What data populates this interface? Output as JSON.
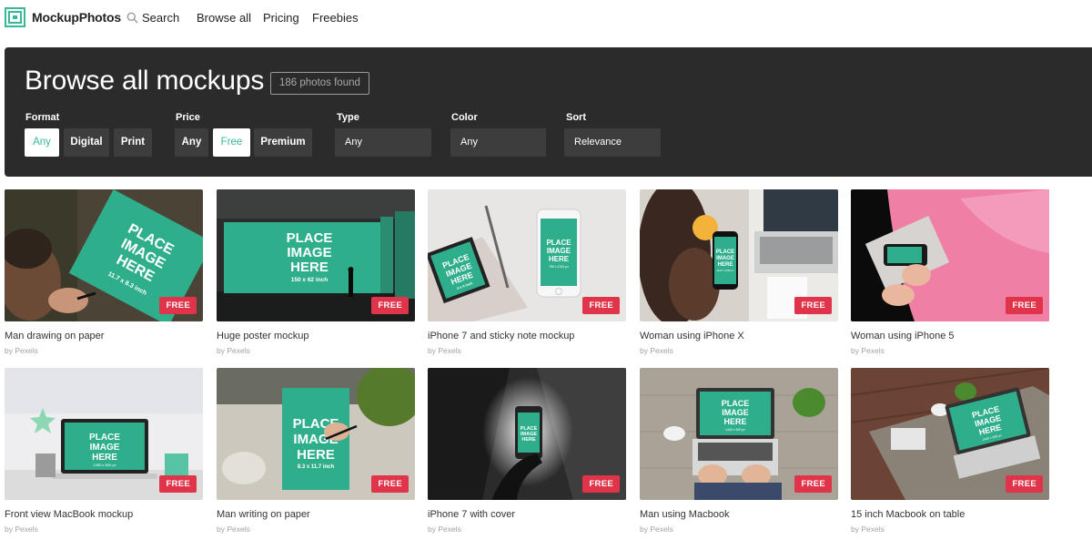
{
  "nav": {
    "logo_text": "MockupPhotos",
    "search_label": "Search",
    "links": [
      "Browse all",
      "Pricing",
      "Freebies"
    ]
  },
  "panel": {
    "title": "Browse all mockups",
    "count": "186 photos found",
    "format": {
      "label": "Format",
      "options": [
        "Any",
        "Digital",
        "Print"
      ],
      "selected": "Any"
    },
    "price": {
      "label": "Price",
      "options": [
        "Any",
        "Free",
        "Premium"
      ],
      "selected": "Free"
    },
    "type": {
      "label": "Type",
      "value": "Any"
    },
    "color": {
      "label": "Color",
      "value": "Any"
    },
    "sort": {
      "label": "Sort",
      "value": "Relevance"
    }
  },
  "mockup_text": {
    "place": "PLACE",
    "image": "IMAGE",
    "here": "HERE",
    "size_paper": "11.7 x 8.3 inch",
    "size_poster": "150 x 62 inch",
    "size_note": "4 x 4 inch",
    "size_phone": "750 x 1334 px",
    "size_phonex": "1125 x 2436 px",
    "size_macbook": "1280 x 800 px",
    "size_writing": "8.3 x 11.7 inch",
    "size_laptop": "1440 x 900 px"
  },
  "badge_label": "FREE",
  "cards": [
    {
      "title": "Man drawing on paper",
      "by": "by Pexels"
    },
    {
      "title": "Huge poster mockup",
      "by": "by Pexels"
    },
    {
      "title": "iPhone 7 and sticky note mockup",
      "by": "by Pexels"
    },
    {
      "title": "Woman using iPhone X",
      "by": "by Pexels"
    },
    {
      "title": "Woman using iPhone 5",
      "by": "by Pexels"
    },
    {
      "title": "Front view MacBook mockup",
      "by": "by Pexels"
    },
    {
      "title": "Man writing on paper",
      "by": "by Pexels"
    },
    {
      "title": "iPhone 7 with cover",
      "by": "by Pexels"
    },
    {
      "title": "Man using Macbook",
      "by": "by Pexels"
    },
    {
      "title": "15 inch Macbook on table",
      "by": "by Pexels"
    }
  ],
  "colors": {
    "accent": "#37b896",
    "mockup_green": "#2fae8c",
    "badge": "#e0344b",
    "panel": "#2b2b2b"
  }
}
